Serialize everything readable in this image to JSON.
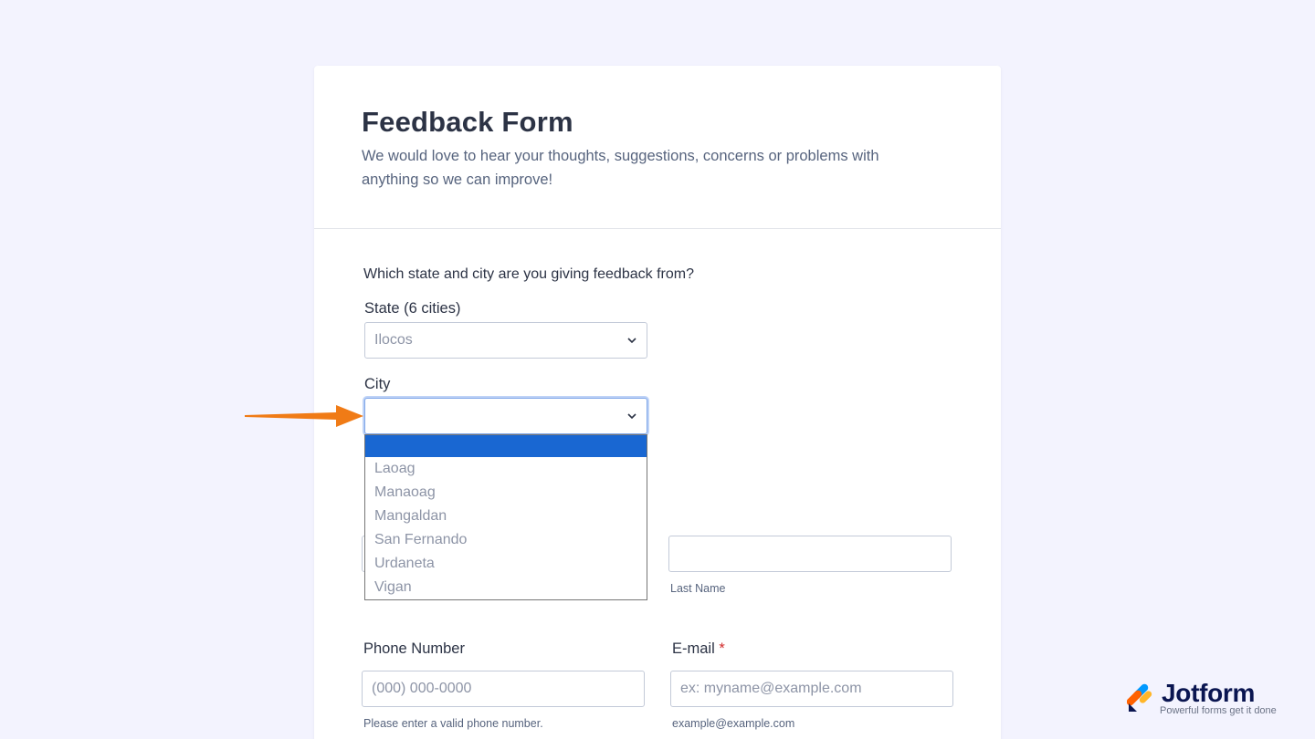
{
  "form": {
    "title": "Feedback Form",
    "subtitle": "We would love to hear your thoughts, suggestions, concerns or problems with anything so we can improve!",
    "question": "Which state and city are you giving feedback from?",
    "state": {
      "label": "State (6 cities)",
      "value": "Ilocos"
    },
    "city": {
      "label": "City",
      "value": "",
      "options": [
        "",
        "Laoag",
        "Manaoag",
        "Mangaldan",
        "San Fernando",
        "Urdaneta",
        "Vigan"
      ]
    },
    "last_name": {
      "sublabel": "Last Name",
      "value": ""
    },
    "phone": {
      "label": "Phone Number",
      "placeholder": "(000) 000-0000",
      "sublabel": "Please enter a valid phone number."
    },
    "email": {
      "label": "E-mail",
      "required_mark": "*",
      "placeholder": "ex: myname@example.com",
      "sublabel": "example@example.com"
    }
  },
  "branding": {
    "name": "Jotform",
    "tagline": "Powerful forms get it done"
  },
  "colors": {
    "background": "#f3f3fe",
    "highlight": "#1967d2",
    "arrow": "#f07b16",
    "required": "#d22b2b"
  }
}
